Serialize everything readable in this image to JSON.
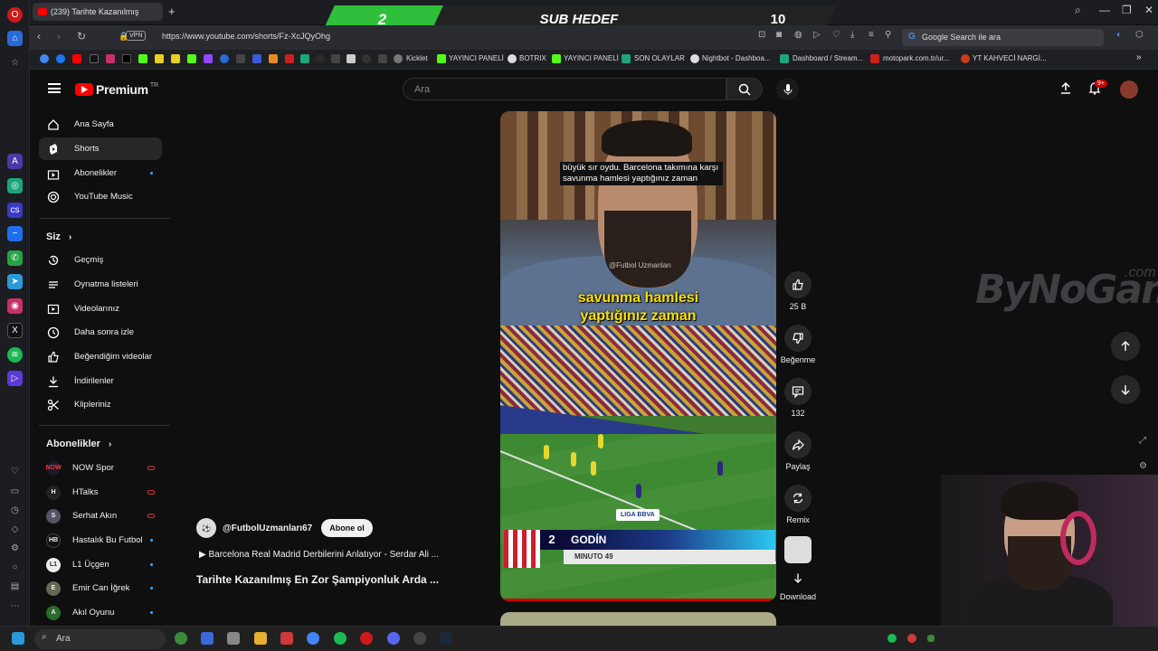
{
  "browser": {
    "tab_title": "(239) Tarihte Kazanılmış",
    "url": "https://www.youtube.com/shorts/Fz-XcJQyOhg",
    "vpn_label": "VPN",
    "google_search_placeholder": "Google Search ile ara"
  },
  "stream_overlay": {
    "current": "2",
    "label": "SUB HEDEF",
    "goal": "10"
  },
  "bookmarks": [
    "Kicklet",
    "YAYINCI PANELİ",
    "BOTRIX",
    "YAYINCI PANELİ",
    "SON OLAYLAR",
    "Nightbot - Dashboa...",
    "Dashboard / Stream...",
    "motopark.com.tr/ur...",
    "YT KAHVECİ NARGİ..."
  ],
  "youtube": {
    "logo_text": "Premium",
    "logo_sup": "TR",
    "search_placeholder": "Ara",
    "notification_count": "9+",
    "sidebar": {
      "main": [
        {
          "label": "Ana Sayfa",
          "icon": "home-icon"
        },
        {
          "label": "Shorts",
          "icon": "shorts-icon"
        },
        {
          "label": "Abonelikler",
          "icon": "subscriptions-icon"
        },
        {
          "label": "YouTube Music",
          "icon": "music-icon"
        }
      ],
      "you_heading": "Siz",
      "you": [
        {
          "label": "Geçmiş",
          "icon": "history-icon"
        },
        {
          "label": "Oynatma listeleri",
          "icon": "playlists-icon"
        },
        {
          "label": "Videolarınız",
          "icon": "your-videos-icon"
        },
        {
          "label": "Daha sonra izle",
          "icon": "watch-later-icon"
        },
        {
          "label": "Beğendiğim videolar",
          "icon": "liked-icon"
        },
        {
          "label": "İndirilenler",
          "icon": "download-icon"
        },
        {
          "label": "Klipleriniz",
          "icon": "clips-icon"
        }
      ],
      "subs_heading": "Abonelikler",
      "subs": [
        {
          "label": "NOW Spor",
          "avatar": "NOW",
          "color": "#1a1a2a"
        },
        {
          "label": "HTalks",
          "avatar": "H",
          "color": "#222"
        },
        {
          "label": "Serhat Akın",
          "avatar": "S",
          "color": "#556"
        },
        {
          "label": "Hastalık Bu Futbol",
          "avatar": "HB",
          "color": "#111"
        },
        {
          "label": "L1 Üçgen",
          "avatar": "L1",
          "color": "#eee"
        },
        {
          "label": "Emir Can İğrek",
          "avatar": "E",
          "color": "#665"
        },
        {
          "label": "Akıl Oyunu",
          "avatar": "A",
          "color": "#2a6a2a"
        }
      ]
    },
    "short": {
      "caption_small": "büyük sır oydu. Barcelona takımına karşı savunma hamlesi yaptığınız zaman",
      "watermark": "@Futbol Uzmanları",
      "caption_big_1": "savunma hamlesi",
      "caption_big_2": "yaptığınız zaman",
      "league_logo": "LIGA BBVA",
      "player_number": "2",
      "player_name": "GODÍN",
      "minute": "MINUTO 49"
    },
    "actions": {
      "likes": "25 B",
      "dislike": "Beğenme",
      "comments": "132",
      "share": "Paylaş",
      "remix": "Remix",
      "download": "Download"
    },
    "channel": {
      "handle": "@FutbolUzmanları67",
      "subscribe": "Abone ol",
      "playlist": "Barcelona Real Madrid Derbilerini Anlatıyor - Serdar Ali ...",
      "title": "Tarihte Kazanılmış En Zor Şampiyonluk Arda ..."
    },
    "watermark_brand": "ByNoGame",
    "watermark_brand_tld": ".com"
  },
  "taskbar": {
    "search_label": "Ara"
  }
}
